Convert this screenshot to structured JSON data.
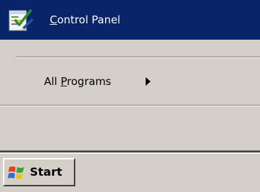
{
  "start_menu": {
    "control_panel": {
      "label_mnemonic": "C",
      "label_rest": "ontrol Panel",
      "icon": "control-panel-icon"
    },
    "all_programs": {
      "label_prefix": "All ",
      "label_mnemonic": "P",
      "label_rest": "rograms",
      "arrow_icon": "submenu-arrow-icon"
    }
  },
  "taskbar": {
    "start_label": "Start",
    "start_icon": "windows-logo-icon"
  },
  "colors": {
    "selection": "#0a246a",
    "face": "#d4d0c8"
  }
}
